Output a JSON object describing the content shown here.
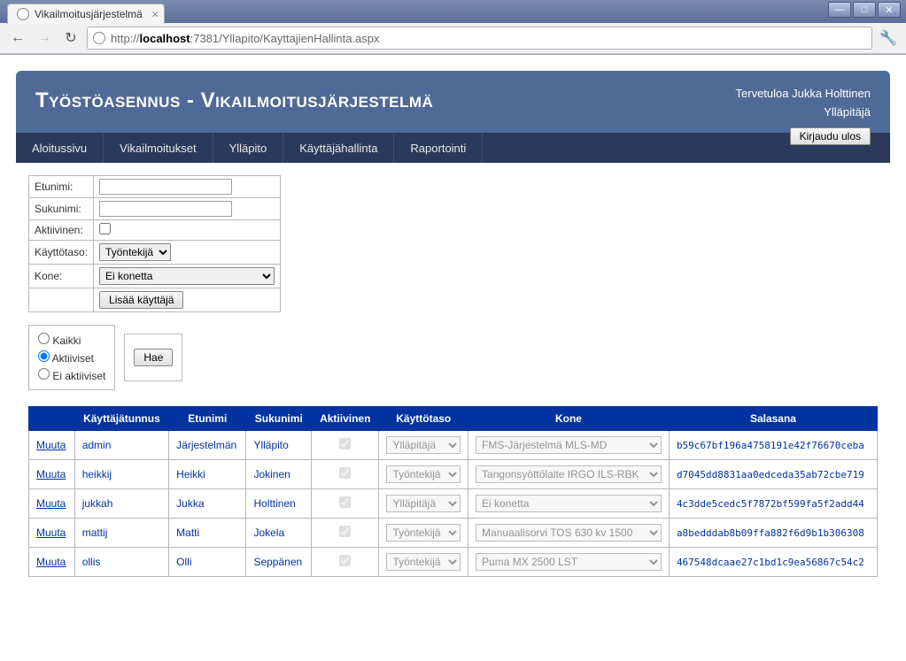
{
  "browser": {
    "tab_title": "Vikailmoitusjärjestelmä",
    "url_prefix": "http://",
    "url_host": "localhost",
    "url_path": ":7381/Yllapito/KayttajienHallinta.aspx"
  },
  "header": {
    "title_part1": "Työstöasennus",
    "title_sep": " - ",
    "title_part2": "Vikailmoitusjärjestelmä",
    "welcome": "Tervetuloa Jukka Holttinen",
    "role": "Ylläpitäjä",
    "logout_label": "Kirjaudu ulos"
  },
  "nav": {
    "items": [
      "Aloitussivu",
      "Vikailmoitukset",
      "Ylläpito",
      "Käyttäjähallinta",
      "Raportointi"
    ]
  },
  "form": {
    "labels": {
      "etunimi": "Etunimi:",
      "sukunimi": "Sukunimi:",
      "aktiivinen": "Aktiivinen:",
      "kayttotaso": "Käyttötaso:",
      "kone": "Kone:"
    },
    "kayttotaso_selected": "Työntekijä",
    "kone_selected": "Ei konetta",
    "add_user_label": "Lisää käyttäjä"
  },
  "filter": {
    "options": {
      "kaikki": "Kaikki",
      "aktiiviset": "Aktiiviset",
      "ei_aktiiviset": "Ei aktiiviset"
    },
    "selected": "aktiiviset",
    "search_label": "Hae"
  },
  "table": {
    "edit_label": "Muuta",
    "headers": [
      "",
      "Käyttäjätunnus",
      "Etunimi",
      "Sukunimi",
      "Aktiivinen",
      "Käyttötaso",
      "Kone",
      "Salasana"
    ],
    "rows": [
      {
        "username": "admin",
        "firstname": "Järjestelmän",
        "lastname": "Ylläpito",
        "active": true,
        "role": "Ylläpitäjä",
        "machine": "FMS-Järjestelmä MLS-MD",
        "password": "b59c67bf196a4758191e42f76670ceba"
      },
      {
        "username": "heikkij",
        "firstname": "Heikki",
        "lastname": "Jokinen",
        "active": true,
        "role": "Työntekijä",
        "machine": "Tangonsyöttölaite IRGO ILS-RBK",
        "password": "d7045dd8831aa0edceda35ab72cbe719"
      },
      {
        "username": "jukkah",
        "firstname": "Jukka",
        "lastname": "Holttinen",
        "active": true,
        "role": "Ylläpitäjä",
        "machine": "Ei konetta",
        "password": "4c3dde5cedc5f7872bf599fa5f2add44"
      },
      {
        "username": "mattij",
        "firstname": "Matti",
        "lastname": "Jokela",
        "active": true,
        "role": "Työntekijä",
        "machine": "Manuaalisorvi TOS 630 kv 1500",
        "password": "a8bedddab8b09ffa882f6d9b1b306308"
      },
      {
        "username": "ollis",
        "firstname": "Olli",
        "lastname": "Seppänen",
        "active": true,
        "role": "Työntekijä",
        "machine": "Puma MX 2500 LST",
        "password": "467548dcaae27c1bd1c9ea56867c54c2"
      }
    ]
  }
}
